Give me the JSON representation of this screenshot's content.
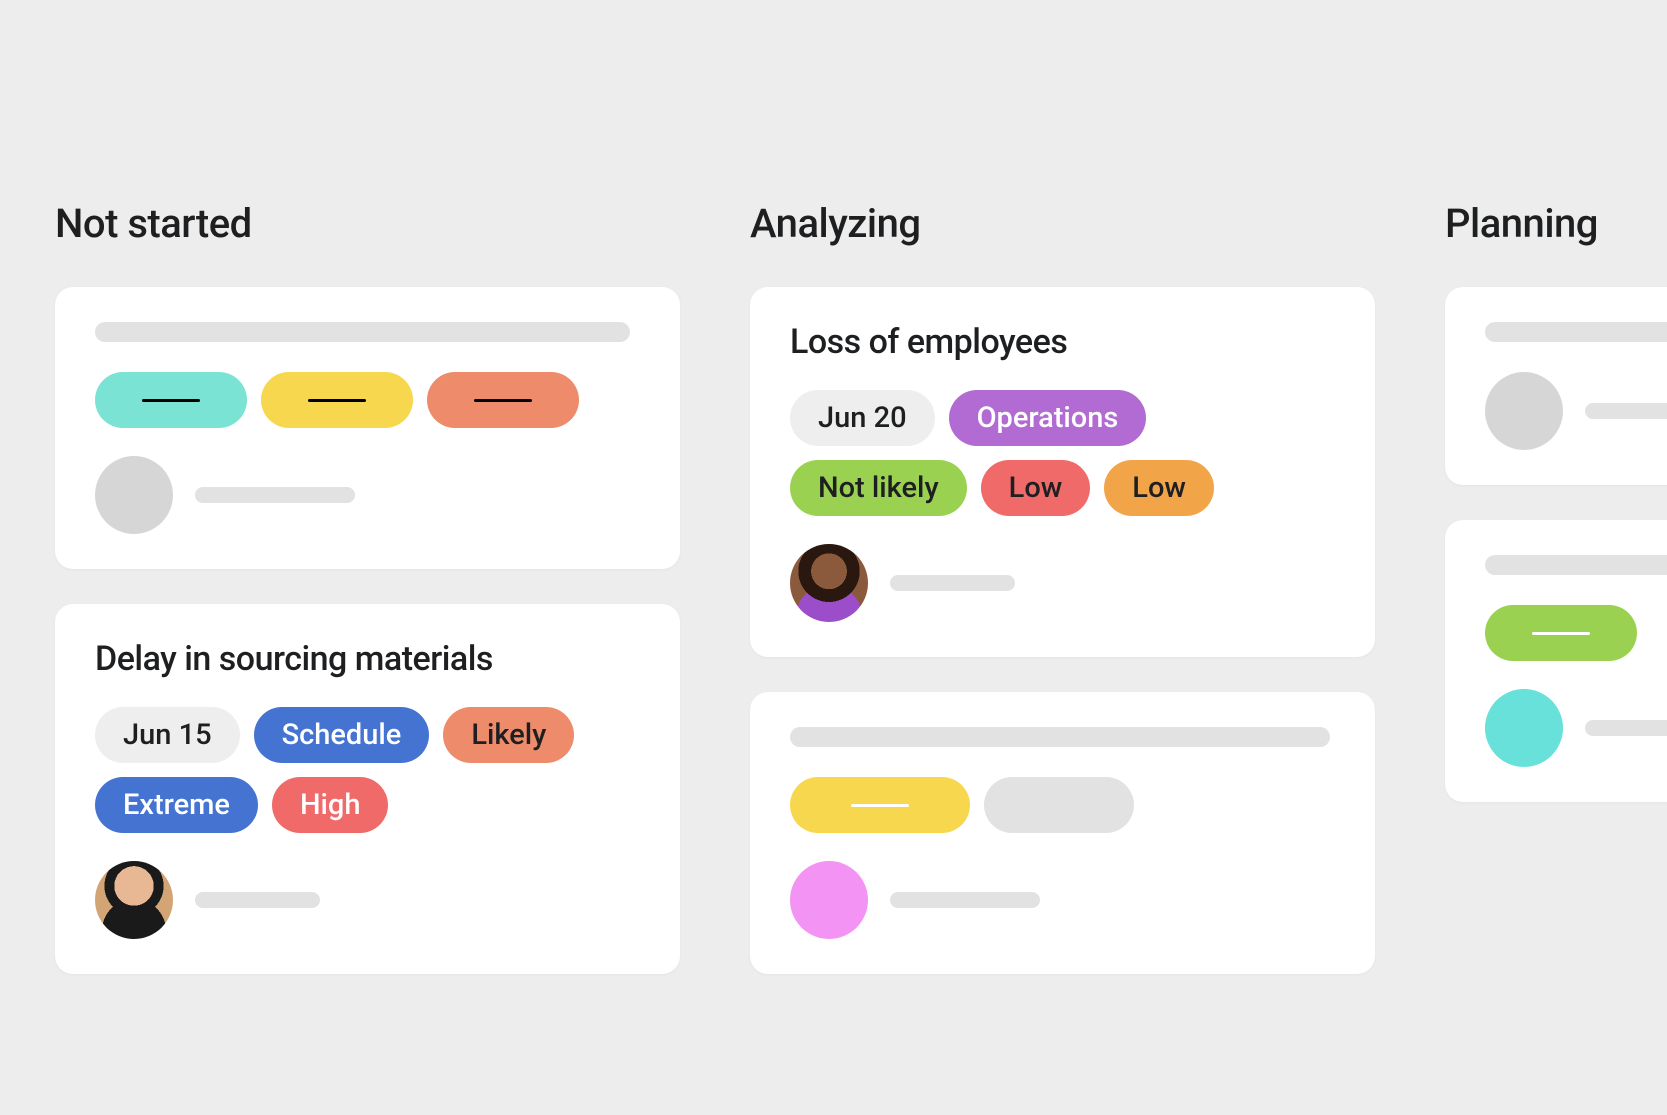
{
  "columns": [
    {
      "title": "Not started"
    },
    {
      "title": "Analyzing"
    },
    {
      "title": "Planning"
    }
  ],
  "cards": {
    "delay_sourcing": {
      "title": "Delay in sourcing materials",
      "tags": {
        "date": "Jun 15",
        "category": "Schedule",
        "likelihood": "Likely",
        "severity": "Extreme",
        "impact": "High"
      }
    },
    "loss_employees": {
      "title": "Loss of employees",
      "tags": {
        "date": "Jun 20",
        "category": "Operations",
        "likelihood": "Not likely",
        "severity": "Low",
        "impact": "Low"
      }
    }
  },
  "colors": {
    "teal": "#7ae3d4",
    "yellow": "#f7d74d",
    "coral": "#ed8b6a",
    "lightgrey": "#eeeeee",
    "blue": "#4573d2",
    "red": "#f06a6a",
    "purple": "#b36bd4",
    "green": "#9ad151",
    "amber": "#f1a448"
  }
}
